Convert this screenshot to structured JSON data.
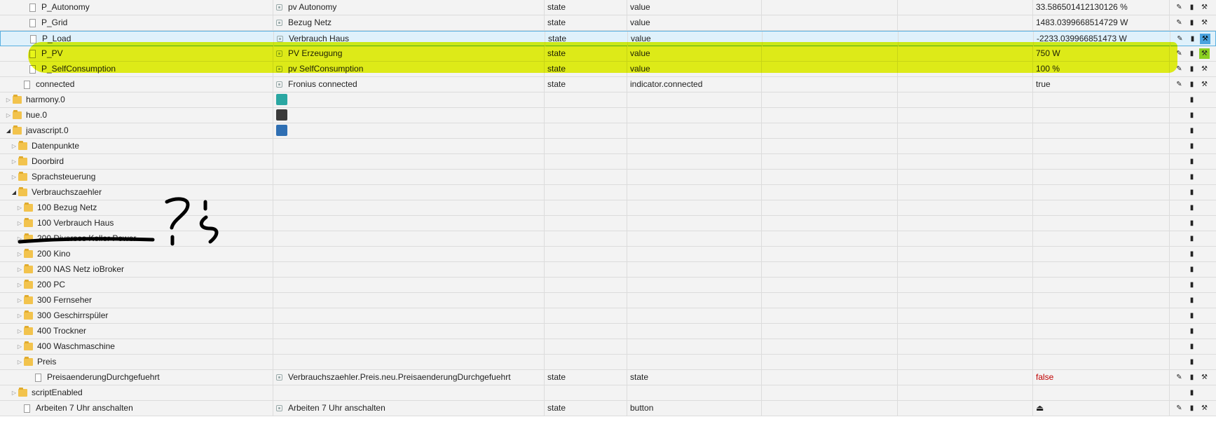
{
  "colors": {
    "highlight": "#e6f500",
    "selected_row": "#dff1fb",
    "false_value": "#c00000",
    "action_blue": "#4aa3df"
  },
  "rows": [
    {
      "name": "P_Autonomy",
      "depth": 3,
      "kind": "state",
      "label": "pv Autonomy",
      "type": "state",
      "role": "value",
      "value": "33.586501412130126 %",
      "actions": [
        "edit-icon",
        "trash-icon",
        "wrench-icon"
      ]
    },
    {
      "name": "P_Grid",
      "depth": 3,
      "kind": "state",
      "label": "Bezug Netz",
      "type": "state",
      "role": "value",
      "value": "1483.0399668514729 W",
      "actions": [
        "edit-icon",
        "trash-icon",
        "wrench-icon"
      ]
    },
    {
      "name": "P_Load",
      "depth": 3,
      "kind": "state",
      "label": "Verbrauch Haus",
      "type": "state",
      "role": "value",
      "value": "-2233.039966851473 W",
      "selected": true,
      "actions": [
        "edit-icon",
        "trash-icon",
        "wrench-icon"
      ]
    },
    {
      "name": "P_PV",
      "depth": 3,
      "kind": "state",
      "label": "PV Erzeugung",
      "type": "state",
      "role": "value",
      "value": "750 W",
      "highlight": true,
      "actions": [
        "edit-icon",
        "trash-icon",
        "wrench-icon"
      ]
    },
    {
      "name": "P_SelfConsumption",
      "depth": 3,
      "kind": "state",
      "label": "pv SelfConsumption",
      "type": "state",
      "role": "value",
      "value": "100 %",
      "actions": [
        "edit-icon",
        "trash-icon",
        "wrench-icon"
      ]
    },
    {
      "name": "connected",
      "depth": 2,
      "kind": "state",
      "label": "Fronius connected",
      "type": "state",
      "role": "indicator.connected",
      "value": "true",
      "actions": [
        "edit-icon",
        "trash-icon",
        "wrench-icon"
      ]
    },
    {
      "name": "harmony.0",
      "depth": 0,
      "kind": "folder",
      "toggle": "closed",
      "adapter": "harmony",
      "actions": [
        "trash-icon"
      ]
    },
    {
      "name": "hue.0",
      "depth": 0,
      "kind": "folder",
      "toggle": "closed",
      "adapter": "hue",
      "actions": [
        "trash-icon"
      ]
    },
    {
      "name": "javascript.0",
      "depth": 0,
      "kind": "folder",
      "toggle": "open",
      "adapter": "javascript",
      "actions": [
        "trash-icon"
      ]
    },
    {
      "name": "Datenpunkte",
      "depth": 1,
      "kind": "folder",
      "toggle": "closed",
      "actions": [
        "trash-icon"
      ]
    },
    {
      "name": "Doorbird",
      "depth": 1,
      "kind": "folder",
      "toggle": "closed",
      "actions": [
        "trash-icon"
      ]
    },
    {
      "name": "Sprachsteuerung",
      "depth": 1,
      "kind": "folder",
      "toggle": "closed",
      "actions": [
        "trash-icon"
      ]
    },
    {
      "name": "Verbrauchszaehler",
      "depth": 1,
      "kind": "folder",
      "toggle": "open",
      "actions": [
        "trash-icon"
      ]
    },
    {
      "name": "100 Bezug Netz",
      "depth": 2,
      "kind": "folder",
      "toggle": "closed",
      "actions": [
        "trash-icon"
      ]
    },
    {
      "name": "100 Verbrauch Haus",
      "depth": 2,
      "kind": "folder",
      "toggle": "closed",
      "actions": [
        "trash-icon"
      ]
    },
    {
      "name": "200 Diverses Keller Power",
      "depth": 2,
      "kind": "folder",
      "toggle": "closed",
      "actions": [
        "trash-icon"
      ]
    },
    {
      "name": "200 Kino",
      "depth": 2,
      "kind": "folder",
      "toggle": "closed",
      "actions": [
        "trash-icon"
      ]
    },
    {
      "name": "200 NAS Netz ioBroker",
      "depth": 2,
      "kind": "folder",
      "toggle": "closed",
      "actions": [
        "trash-icon"
      ]
    },
    {
      "name": "200 PC",
      "depth": 2,
      "kind": "folder",
      "toggle": "closed",
      "actions": [
        "trash-icon"
      ]
    },
    {
      "name": "300 Fernseher",
      "depth": 2,
      "kind": "folder",
      "toggle": "closed",
      "actions": [
        "trash-icon"
      ]
    },
    {
      "name": "300 Geschirrspüler",
      "depth": 2,
      "kind": "folder",
      "toggle": "closed",
      "actions": [
        "trash-icon"
      ]
    },
    {
      "name": "400 Trockner",
      "depth": 2,
      "kind": "folder",
      "toggle": "closed",
      "actions": [
        "trash-icon"
      ]
    },
    {
      "name": "400 Waschmaschine",
      "depth": 2,
      "kind": "folder",
      "toggle": "closed",
      "actions": [
        "trash-icon"
      ]
    },
    {
      "name": "Preis",
      "depth": 2,
      "kind": "folder",
      "toggle": "closed",
      "actions": [
        "trash-icon"
      ]
    },
    {
      "name": "PreisaenderungDurchgefuehrt",
      "depth": 4,
      "kind": "state",
      "label": "Verbrauchszaehler.Preis.neu.PreisaenderungDurchgefuehrt",
      "type": "state",
      "role": "state",
      "value": "false",
      "value_red": true,
      "actions": [
        "edit-icon",
        "trash-icon",
        "wrench-icon"
      ]
    },
    {
      "name": "scriptEnabled",
      "depth": 1,
      "kind": "folder",
      "toggle": "closed",
      "actions": [
        "trash-icon"
      ]
    },
    {
      "name": "Arbeiten 7 Uhr anschalten",
      "depth": 2,
      "kind": "state",
      "label": "Arbeiten 7 Uhr anschalten",
      "type": "state",
      "role": "button",
      "value": "⏏",
      "actions": [
        "edit-icon",
        "trash-icon",
        "wrench-icon"
      ]
    }
  ],
  "annotation": {
    "text": "?¿"
  }
}
